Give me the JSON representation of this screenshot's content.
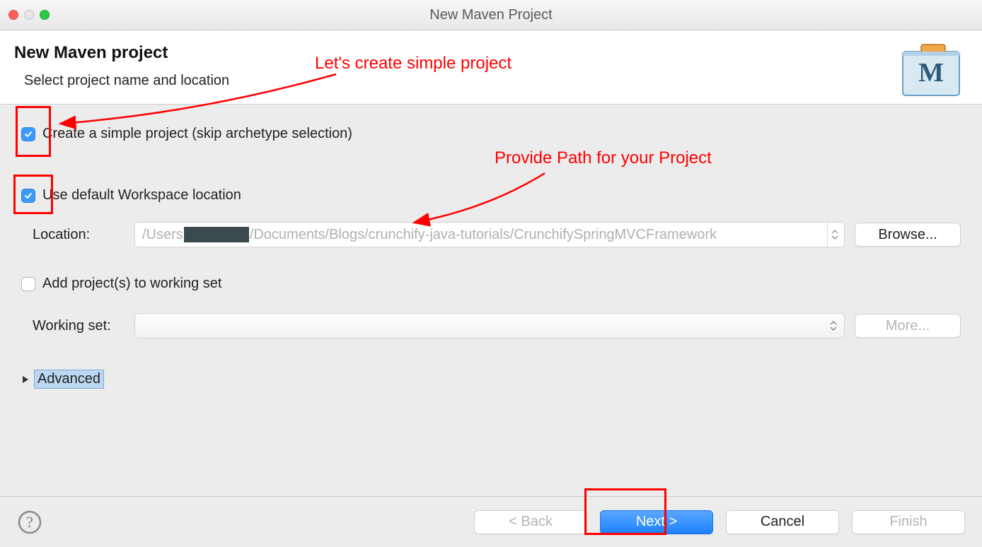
{
  "titlebar": {
    "title": "New Maven Project"
  },
  "header": {
    "title": "New Maven project",
    "subtitle": "Select project name and location"
  },
  "form": {
    "simple_project_label": "Create a simple project (skip archetype selection)",
    "simple_project_checked": true,
    "default_ws_label": "Use default Workspace location",
    "default_ws_checked": true,
    "location_label": "Location:",
    "location_value_parts": {
      "prefix": "/Users",
      "suffix": "/Documents/Blogs/crunchify-java-tutorials/CrunchifySpringMVCFramework"
    },
    "browse_label": "Browse...",
    "add_ws_label": "Add project(s) to working set",
    "add_ws_checked": false,
    "working_set_label": "Working set:",
    "more_label": "More...",
    "advanced_label": "Advanced"
  },
  "annotations": {
    "top": "Let's create simple project",
    "right": "Provide Path for your Project"
  },
  "footer": {
    "back": "< Back",
    "next": "Next >",
    "cancel": "Cancel",
    "finish": "Finish"
  }
}
